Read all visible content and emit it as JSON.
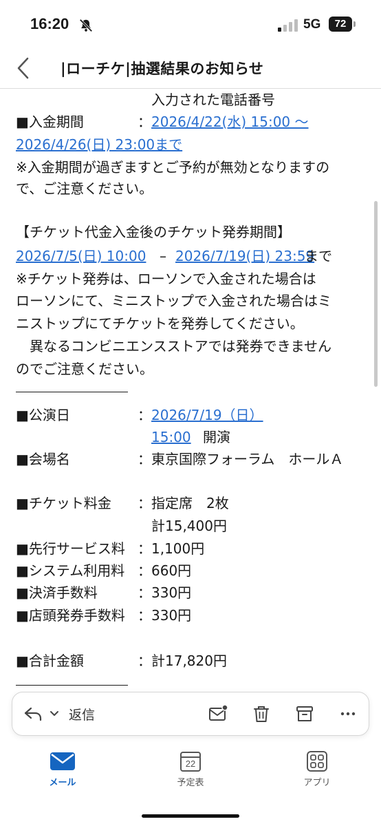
{
  "status": {
    "time": "16:20",
    "network": "5G",
    "battery": "72"
  },
  "header": {
    "title": "|ローチケ|抽選結果のお知らせ"
  },
  "body": {
    "l0": "入力された電話番号",
    "l1_label": "■入金期間",
    "l1_colon": "：",
    "l1_link": "2026/4/22(水) 15:00 〜",
    "l2_link": "2026/4/26(日) 23:00まで",
    "l3": "※入金期間が過ぎますとご予約が無効となりますの",
    "l4": "で、ご注意ください。",
    "l5": "【チケット代金入金後のチケット発券期間】",
    "l6_link1": "2026/7/5(日) 10:00",
    "l6_dash": "–",
    "l6_link2": "2026/7/19(日) 23:59",
    "l6_tail": "まで",
    "l7": "※チケット発券は、ローソンで入金された場合は",
    "l8": "ローソンにて、ミニストップで入金された場合はミ",
    "l9": "ニストップにてチケットを発券してください。",
    "l10": "　異なるコンビニエンスストアでは発券できません",
    "l11": "のでご注意ください。",
    "perf_label": "■公演日",
    "perf_colon": "：",
    "perf_date": "2026/7/19（日）",
    "perf_time": "15:00",
    "perf_open": "開演",
    "venue_label": "■会場名",
    "venue_value": "：東京国際フォーラム　ホールＡ",
    "price_label": "■チケット料金",
    "price_value": "：指定席　2枚",
    "price_total": "計15,400円",
    "fee1_label": "■先行サービス料",
    "fee1_value": "：1,100円",
    "fee2_label": "■システム利用料",
    "fee2_value": "：660円",
    "fee3_label": "■決済手数料",
    "fee3_value": "：330円",
    "fee4_label": "■店頭発券手数料",
    "fee4_value": "：330円",
    "total_label": "■合計金額",
    "total_value": "：計17,820円"
  },
  "reply_bar": {
    "label": "返信"
  },
  "nav": {
    "mail": "メール",
    "calendar": "予定表",
    "calendar_day": "22",
    "apps": "アプリ"
  },
  "colors": {
    "link": "#2a6fd0",
    "active_tab": "#1565c0"
  }
}
